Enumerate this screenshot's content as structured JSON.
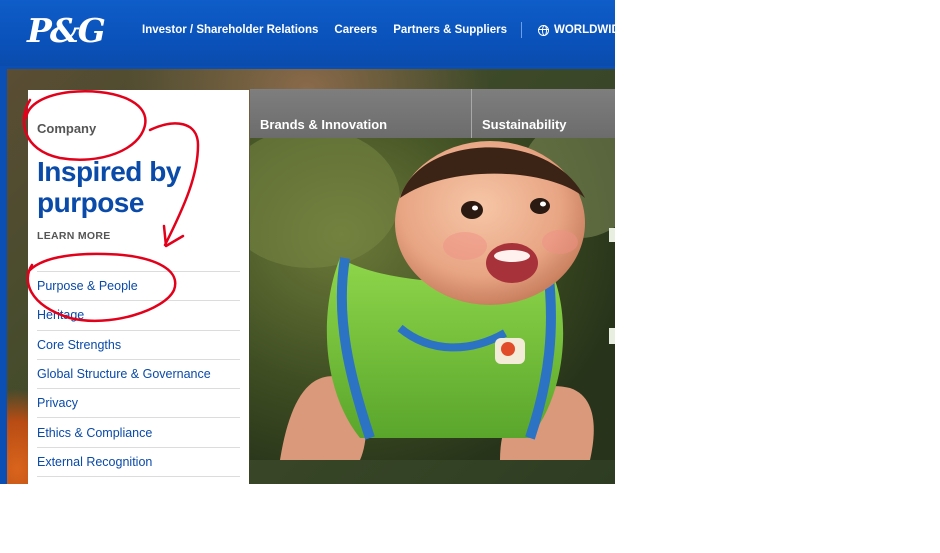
{
  "brand": {
    "logo_text": "P&G"
  },
  "topnav": {
    "items": [
      "Investor / Shareholder Relations",
      "Careers",
      "Partners & Suppliers"
    ],
    "worldwide": "WORLDWIDE"
  },
  "sidebar": {
    "section": "Company",
    "headline": "Inspired by purpose",
    "learn_more": "LEARN MORE",
    "items": [
      "Purpose & People",
      "Heritage",
      "Core Strengths",
      "Global Structure & Governance",
      "Privacy",
      "Ethics & Compliance",
      "External Recognition"
    ]
  },
  "tabs": [
    "Brands & Innovation",
    "Sustainability"
  ],
  "colors": {
    "header_blue": "#0b4fb4",
    "link_blue": "#0a4aa8",
    "annotation_red": "#e2001a",
    "tab_gray": "#747474"
  },
  "icons": {
    "worldwide": "globe-icon"
  }
}
